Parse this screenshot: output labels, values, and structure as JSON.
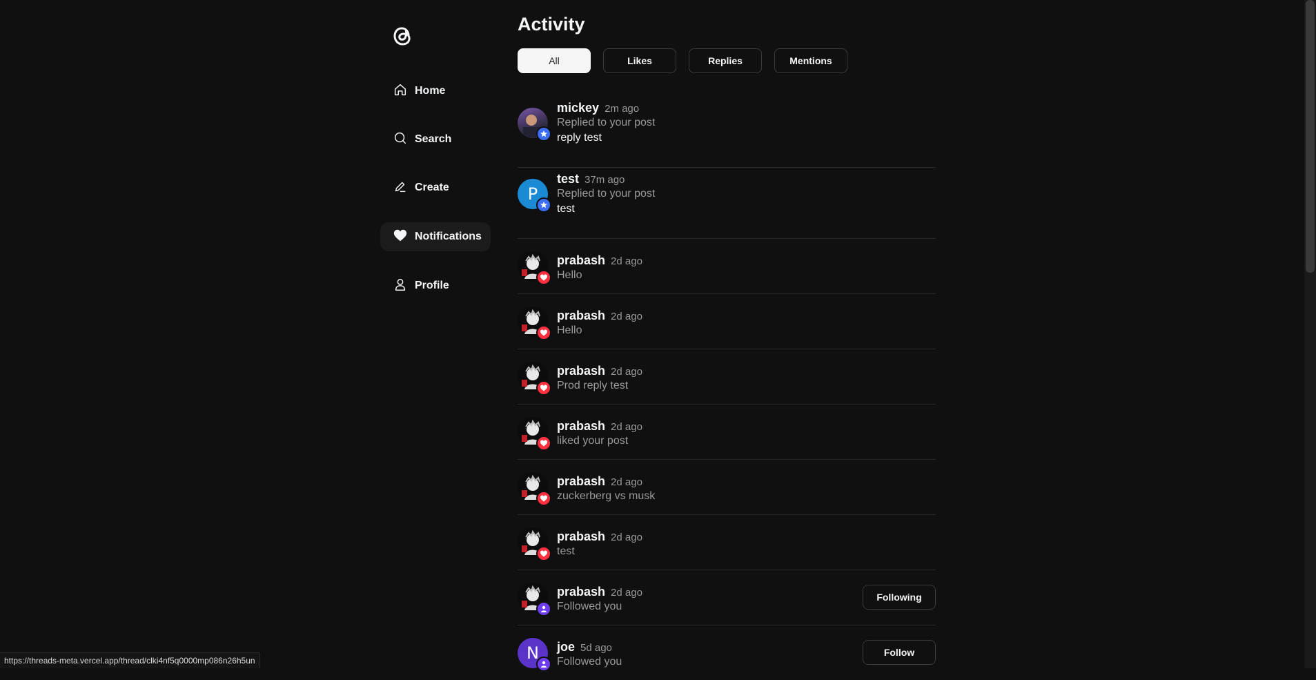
{
  "nav": {
    "items": [
      {
        "label": "Home",
        "icon": "home-icon"
      },
      {
        "label": "Search",
        "icon": "search-icon"
      },
      {
        "label": "Create",
        "icon": "pencil-icon"
      },
      {
        "label": "Notifications",
        "icon": "heart-icon",
        "active": true
      },
      {
        "label": "Profile",
        "icon": "person-icon"
      }
    ]
  },
  "page": {
    "title": "Activity"
  },
  "filters": [
    "All",
    "Likes",
    "Replies",
    "Mentions"
  ],
  "activities": [
    {
      "name": "mickey",
      "time": "2m ago",
      "sub": "Replied to your post",
      "body": "reply test",
      "badge": "reply"
    },
    {
      "name": "test",
      "time": "37m ago",
      "sub": "Replied to your post",
      "body": "test",
      "badge": "reply",
      "avatar_letter": "P"
    },
    {
      "name": "prabash",
      "time": "2d ago",
      "sub": "Hello",
      "badge": "like"
    },
    {
      "name": "prabash",
      "time": "2d ago",
      "sub": "Hello",
      "badge": "like"
    },
    {
      "name": "prabash",
      "time": "2d ago",
      "sub": "Prod reply test",
      "badge": "like"
    },
    {
      "name": "prabash",
      "time": "2d ago",
      "sub": "liked your post",
      "badge": "like"
    },
    {
      "name": "prabash",
      "time": "2d ago",
      "sub": "zuckerberg vs musk",
      "badge": "like"
    },
    {
      "name": "prabash",
      "time": "2d ago",
      "sub": "test",
      "badge": "like"
    },
    {
      "name": "prabash",
      "time": "2d ago",
      "sub": "Followed you",
      "badge": "follow",
      "action": "Following"
    },
    {
      "name": "joe",
      "time": "5d ago",
      "sub": "Followed you",
      "badge": "follow",
      "action": "Follow",
      "avatar_letter": "N"
    }
  ],
  "status_url": "https://threads-meta.vercel.app/thread/clki4nf5q0000mp086n26h5un",
  "colors": {
    "background": "#101010",
    "reply_badge": "#3b6ef5",
    "like_badge": "#ff3040",
    "follow_badge": "#6e3def"
  }
}
